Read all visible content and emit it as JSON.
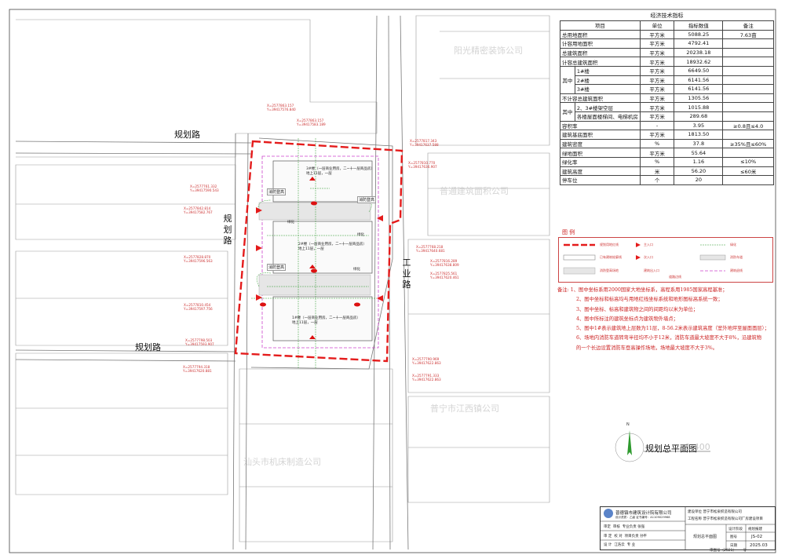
{
  "roads": {
    "left_top": "规划路",
    "left_mid": "规划路",
    "left_bottom": "规划路",
    "right": "工业路"
  },
  "coordinates": [
    "X=2577863.157\nY=39417576.840",
    "X=2577863.157\nY=39417583.189",
    "X=2577817.343\nY=39417637.588",
    "X=2577761.332\nY=39417590.543",
    "X=2577810.770\nY=39417636.907",
    "X=2577842.814\nY=39417582.767",
    "X=2577828.870\nY=39417596.563",
    "X=2577810.454\nY=39417597.756",
    "X=2577798.503\nY=39417593.907",
    "X=2577794.318\nY=39417620.881",
    "X=2577790.969\nY=39417622.863",
    "X=2577768.218\nY=39417640.681",
    "X=2577816.289\nY=39417638.809",
    "X=2577825.561\nY=39417620.461",
    "X=2577791.333\nY=39417622.863"
  ],
  "site": {
    "fire_zone_labels": [
      "消防登高",
      "消防登高",
      "消防登高"
    ],
    "building_notes": [
      "3#楼（一层商业用房，二~十一层商品房）\n地上11层，一层",
      "2#楼（一层商业用房，二~十一层商品房）\n地上11层，一层",
      "1#楼（一层商业用房，二~十一层商品房）\n地上11层，一层"
    ],
    "small_labels": [
      "绿化",
      "绿化",
      "绿化"
    ]
  },
  "neighbors": [
    "阳光精密装饰公司",
    "普通建筑面积公司",
    "普宁市江西镇公司",
    "汕头市机床制造公司"
  ],
  "tech_table": {
    "title": "经济技术指标",
    "headers": [
      "项目",
      "单位",
      "指标数值",
      "备注"
    ],
    "rows": [
      {
        "group": "",
        "item": "总用地面积",
        "unit": "平方米",
        "value": "5088.25",
        "note": "7.63亩"
      },
      {
        "group": "",
        "item": "计容用地面积",
        "unit": "平方米",
        "value": "4792.41",
        "note": ""
      },
      {
        "group": "",
        "item": "总建筑面积",
        "unit": "平方米",
        "value": "20238.18",
        "note": ""
      },
      {
        "group": "",
        "item": "计容总建筑面积",
        "unit": "平方米",
        "value": "18932.62",
        "note": ""
      },
      {
        "group": "其中",
        "item": "1#楼",
        "unit": "平方米",
        "value": "6649.50",
        "note": ""
      },
      {
        "group": "其中",
        "item": "2#楼",
        "unit": "平方米",
        "value": "6141.56",
        "note": ""
      },
      {
        "group": "其中",
        "item": "3#楼",
        "unit": "平方米",
        "value": "6141.56",
        "note": ""
      },
      {
        "group": "",
        "item": "不计容总建筑面积",
        "unit": "平方米",
        "value": "1305.56",
        "note": ""
      },
      {
        "group": "其中",
        "item": "2、3#楼架空层",
        "unit": "平方米",
        "value": "1015.88",
        "note": ""
      },
      {
        "group": "其中",
        "item": "各楼屋面楼梯间、电梯机房",
        "unit": "平方米",
        "value": "289.68",
        "note": ""
      },
      {
        "group": "",
        "item": "容积率",
        "unit": "-",
        "value": "3.95",
        "note": "≥0.8且≤4.0"
      },
      {
        "group": "",
        "item": "建筑基底面积",
        "unit": "平方米",
        "value": "1813.50",
        "note": ""
      },
      {
        "group": "",
        "item": "建筑密度",
        "unit": "%",
        "value": "37.8",
        "note": "≥35%且≤60%"
      },
      {
        "group": "",
        "item": "绿地面积",
        "unit": "平方米",
        "value": "55.64",
        "note": ""
      },
      {
        "group": "",
        "item": "绿化率",
        "unit": "%",
        "value": "1.16",
        "note": "≤10%"
      },
      {
        "group": "",
        "item": "建筑高度",
        "unit": "米",
        "value": "56.20",
        "note": "≤60米"
      },
      {
        "group": "",
        "item": "停车位",
        "unit": "个",
        "value": "20",
        "note": ""
      }
    ]
  },
  "legend": {
    "title": "图 例",
    "items": [
      "规划用地红线",
      "已有建筑轮廓线",
      "建筑出入口",
      "主入口",
      "次入口",
      "消防登高场地",
      "消防车道",
      "绿化",
      "道路边线",
      "建筑退线"
    ]
  },
  "notes": {
    "lead": "备注:",
    "items": [
      "1、图中坐标系用2000国家大地坐标系，高程系用1985国家高程基准；",
      "2、图中坐标和标高均与用地红线坐标系统和地形图标高系统一致；",
      "3、图中坐标、标高和建筑物之间的间距均以米为单位；",
      "4、图中所标注的建筑坐标点为建筑物外墙点；",
      "5、图中1#表示建筑地上层数为11层，8-56.2米表示建筑高度（室外地坪至屋面面层）；",
      "6、场地内消防车道转弯半径均不小于12米，消防车道最大坡度不大于8%，沿建筑物",
      "的一个长边设置消防车登高操作场地，场地最大坡度不大于3%。"
    ]
  },
  "plan": {
    "title": "规划总平面图",
    "scale": "1:400",
    "north": "N"
  },
  "title_block": {
    "company": "普德镇市建筑设计院有限公司",
    "company_en": "设计资质：乙级 证书编号：A1109029968",
    "client_label": "建设单位",
    "client": "普宁市松泉织造有限公司",
    "project_label": "工程名称",
    "project": "普宁市松泉织造有限公司厂房建设项目",
    "drawing_name": "规划总平面图",
    "stage_label": "设计阶段",
    "stage": "规划报建",
    "no_label": "图号",
    "no": "JS-02",
    "date_label": "日期",
    "date": "2025.03",
    "roles": [
      [
        "审定",
        "审核",
        "专业负责",
        "张强"
      ],
      [
        "审 定",
        "校 对",
        "项目负责",
        "孙平"
      ],
      [
        "设 计",
        "江浩云",
        "专 业",
        ""
      ]
    ],
    "cert": "审图号（2021）",
    "cert_suffix": "号"
  },
  "colors": {
    "redline": "#e41b1b",
    "setback": "#cc44cc",
    "green": "#2e9a2e",
    "road": "#777777"
  }
}
